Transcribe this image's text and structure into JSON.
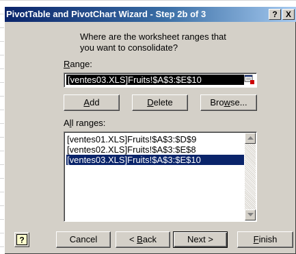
{
  "window": {
    "title": "PivotTable and PivotChart Wizard - Step 2b of 3",
    "help_glyph": "?",
    "close_glyph": "X"
  },
  "prompt": {
    "line1": "Where are the worksheet ranges that",
    "line2": "you want to consolidate?"
  },
  "range": {
    "label_prefix": "",
    "label_underlined": "R",
    "label_rest": "ange:",
    "value": "[ventes03.XLS]Fruits!$A$3:$E$10",
    "collapse_icon": "collapse-dialog-icon"
  },
  "actions": {
    "add": {
      "u": "A",
      "rest": "dd"
    },
    "delete": {
      "u": "D",
      "rest": "elete"
    },
    "browse": {
      "pre": "Bro",
      "u": "w",
      "rest": "se..."
    }
  },
  "all_ranges": {
    "label_prefix": "A",
    "label_underlined": "l",
    "label_rest": "l ranges:",
    "items": [
      "[ventes01.XLS]Fruits!$A$3:$D$9",
      "[ventes02.XLS]Fruits!$A$3:$E$8",
      "[ventes03.XLS]Fruits!$A$3:$E$10"
    ],
    "selected_index": 2
  },
  "footer": {
    "help_icon": "help-icon",
    "cancel": "Cancel",
    "back": {
      "pre": "< ",
      "u": "B",
      "rest": "ack"
    },
    "next": "Next >",
    "finish": {
      "u": "F",
      "rest": "inish"
    }
  },
  "colors": {
    "dialog_face": "#d4d0c8",
    "title_start": "#0a246a",
    "selection": "#0a246a"
  }
}
